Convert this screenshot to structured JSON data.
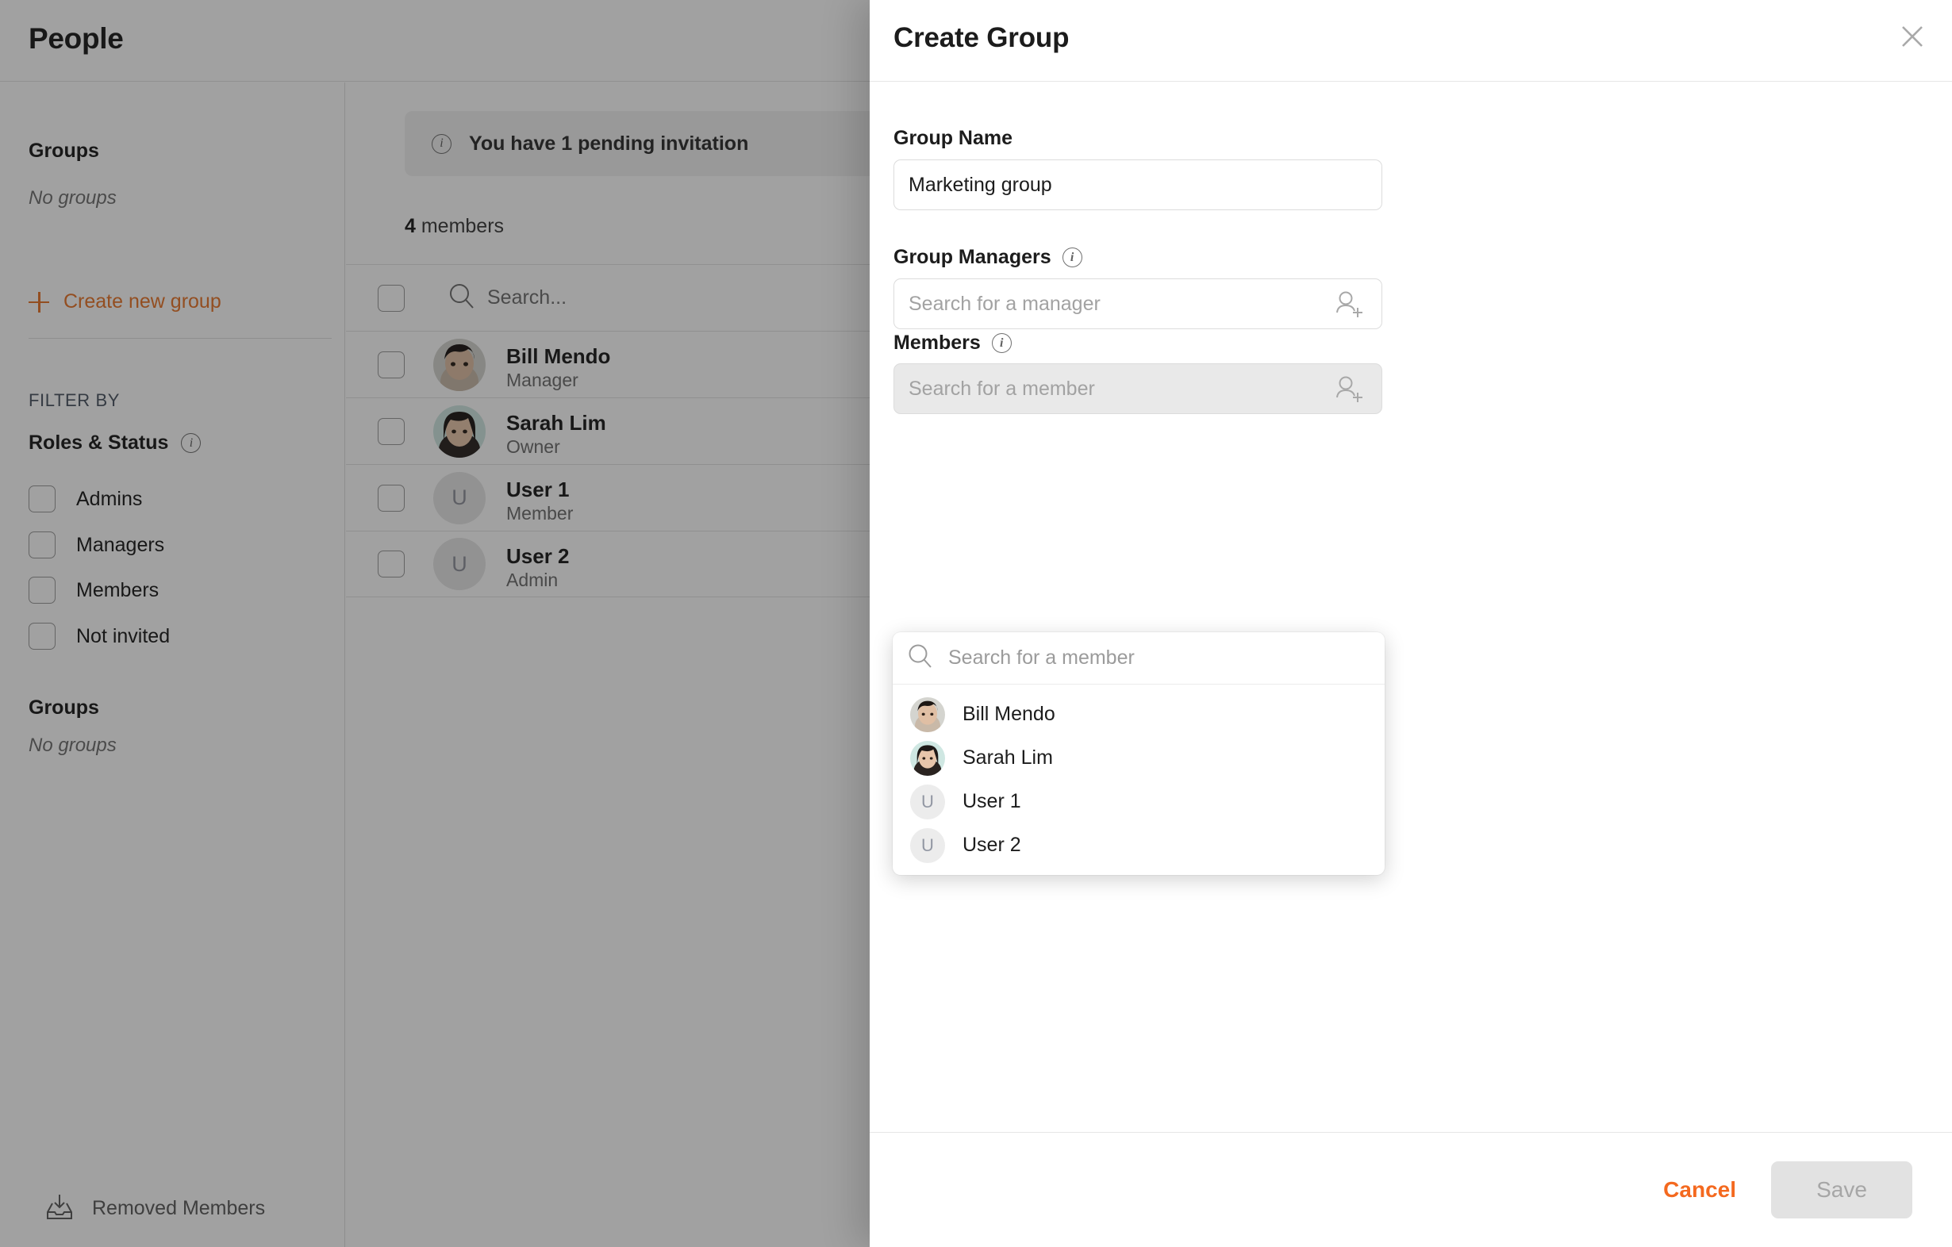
{
  "page": {
    "title": "People"
  },
  "sidebar": {
    "groups_heading": "Groups",
    "no_groups": "No groups",
    "create_new_group": "Create new group",
    "filter_by": "FILTER BY",
    "roles_status_heading": "Roles & Status",
    "info_glyph": "i",
    "filters": [
      {
        "label": "Admins",
        "checked": false
      },
      {
        "label": "Managers",
        "checked": false
      },
      {
        "label": "Members",
        "checked": false
      },
      {
        "label": "Not invited",
        "checked": false
      }
    ],
    "groups_heading_2": "Groups",
    "no_groups_2": "No groups",
    "removed_members": "Removed Members"
  },
  "main": {
    "banner_text": "You have 1 pending invitation",
    "member_count": "4",
    "member_count_suffix": " members",
    "search_placeholder": "Search...",
    "rows": [
      {
        "name": "Bill Mendo",
        "role": "Manager",
        "avatar_type": "photo",
        "avatar_kind": "bill"
      },
      {
        "name": "Sarah Lim",
        "role": "Owner",
        "avatar_type": "photo",
        "avatar_kind": "sarah"
      },
      {
        "name": "User 1",
        "role": "Member",
        "avatar_type": "letter",
        "initial": "U"
      },
      {
        "name": "User 2",
        "role": "Admin",
        "avatar_type": "letter",
        "initial": "U"
      }
    ]
  },
  "drawer": {
    "title": "Create Group",
    "group_name_label": "Group Name",
    "group_name_value": "Marketing group",
    "group_managers_label": "Group Managers",
    "group_managers_placeholder": "Search for a manager",
    "members_label": "Members",
    "members_placeholder": "Search for a member",
    "dropdown": {
      "search_placeholder": "Search for a member",
      "items": [
        {
          "name": "Bill Mendo",
          "avatar_type": "photo",
          "avatar_kind": "bill"
        },
        {
          "name": "Sarah Lim",
          "avatar_type": "photo",
          "avatar_kind": "sarah"
        },
        {
          "name": "User 1",
          "avatar_type": "letter",
          "initial": "U"
        },
        {
          "name": "User 2",
          "avatar_type": "letter",
          "initial": "U"
        }
      ]
    },
    "cancel_label": "Cancel",
    "save_label": "Save"
  },
  "colors": {
    "accent_orange": "#e8762a",
    "cancel_orange": "#f4691f",
    "text_dark": "#1c1c1c",
    "text_muted": "#6d6d6d",
    "border": "#e3e3e3",
    "save_disabled_bg": "#e2e2e2"
  }
}
